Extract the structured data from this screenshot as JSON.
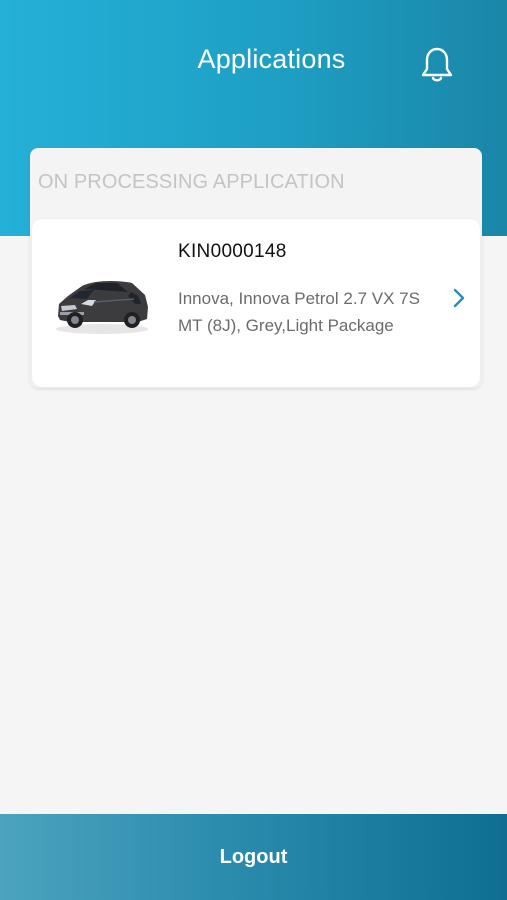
{
  "header": {
    "title": "Applications",
    "notification_icon": "bell-icon"
  },
  "section": {
    "label": "ON PROCESSING APPLICATION"
  },
  "applications": [
    {
      "id": "KIN0000148",
      "description": "Innova, Innova Petrol 2.7 VX 7S MT (8J), Grey,Light Package",
      "image": "car-image",
      "action_icon": "chevron-right-icon"
    }
  ],
  "footer": {
    "logout_label": "Logout"
  },
  "colors": {
    "header_start": "#25b0d8",
    "header_end": "#1a86a8",
    "footer_start": "#4ba3bf",
    "footer_end": "#0f6e92",
    "accent": "#2b8fb3",
    "background": "#f5f5f5"
  }
}
